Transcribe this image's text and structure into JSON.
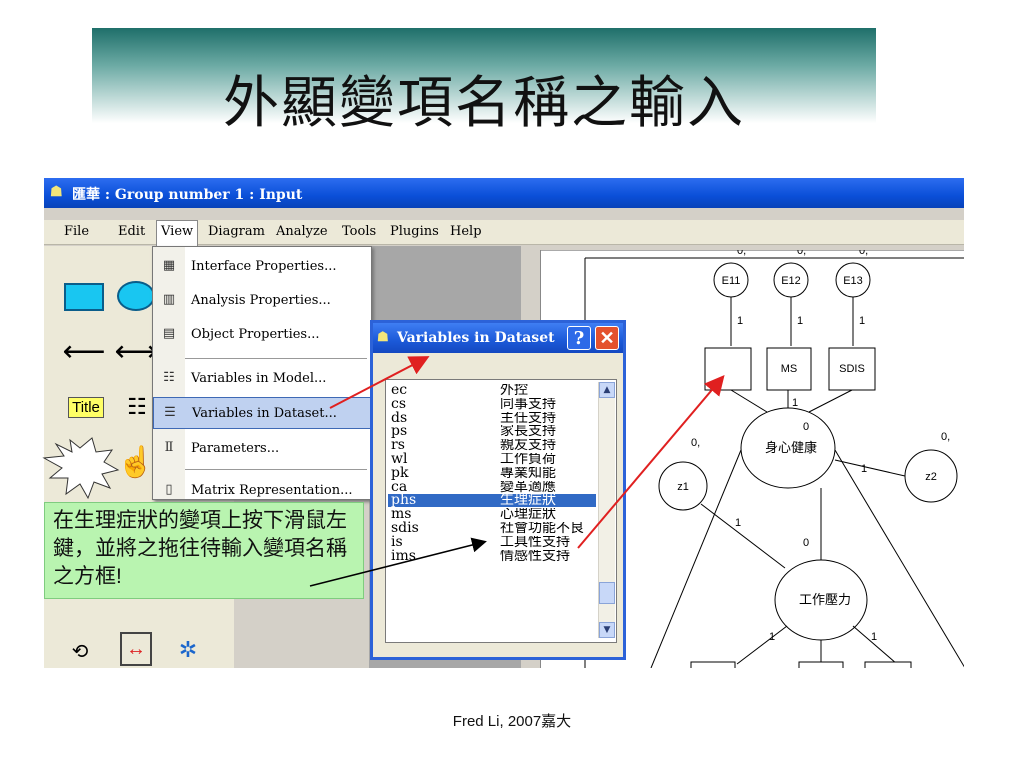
{
  "slide_title": "外顯變項名稱之輸入",
  "window": {
    "title": "匯華 : Group number 1 : Input"
  },
  "menubar": [
    "File",
    "Edit",
    "View",
    "Diagram",
    "Analyze",
    "Tools",
    "Plugins",
    "Help"
  ],
  "view_menu": [
    "Interface Properties...",
    "Analysis Properties...",
    "Object Properties...",
    "Variables in Model...",
    "Variables in Dataset...",
    "Parameters...",
    "Matrix Representation..."
  ],
  "toolbox": {
    "title_tool": "Title"
  },
  "dialog": {
    "title": "Variables in Dataset",
    "help_label": "?",
    "close_label": "✕",
    "rows": [
      {
        "code": "ec",
        "name": "外控"
      },
      {
        "code": "cs",
        "name": "同事支持"
      },
      {
        "code": "ds",
        "name": "主任支持"
      },
      {
        "code": "ps",
        "name": "家長支持"
      },
      {
        "code": "rs",
        "name": "親友支持"
      },
      {
        "code": "wl",
        "name": "工作負荷"
      },
      {
        "code": "pk",
        "name": "專業知能"
      },
      {
        "code": "ca",
        "name": "變革適應"
      },
      {
        "code": "phs",
        "name": "生理症狀"
      },
      {
        "code": "ms",
        "name": "心理症狀"
      },
      {
        "code": "sdis",
        "name": "社會功能不良"
      },
      {
        "code": "is",
        "name": "工具性支持"
      },
      {
        "code": "ims",
        "name": "情感性支持"
      }
    ],
    "selected_row": 8
  },
  "diagram": {
    "errors": [
      "E11",
      "E12",
      "E13"
    ],
    "indicators": [
      "MS",
      "SDIS"
    ],
    "latent1": "身心健康",
    "latent2": "工作壓力",
    "disturbances": [
      "z1",
      "z2"
    ],
    "path_one": "1",
    "param_zero": "0",
    "param_zero_comma": "0,"
  },
  "note": "在生理症狀的變項上按下滑鼠左鍵，並將之拖往待輸入變項名稱之方框!",
  "footer": "Fred Li, 2007嘉大"
}
